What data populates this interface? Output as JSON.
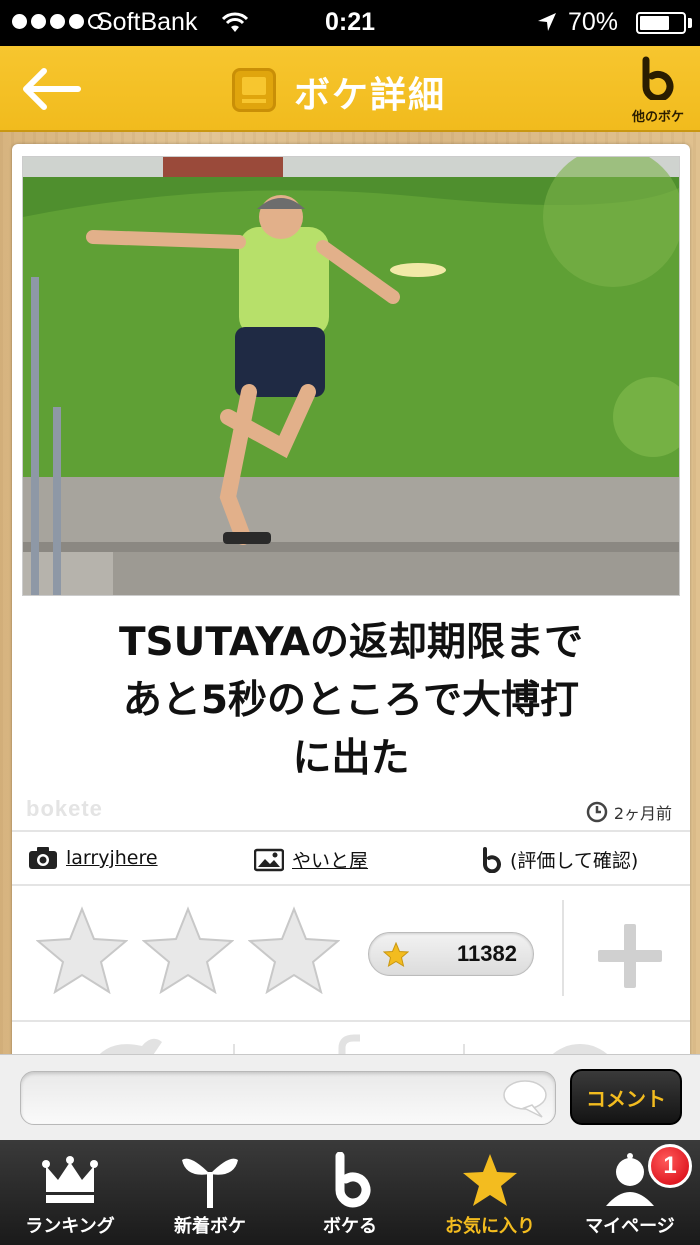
{
  "status_bar": {
    "carrier": "SoftBank",
    "time": "0:21",
    "battery_percent": "70%",
    "battery_level": 0.7
  },
  "nav": {
    "title": "ボケ詳細",
    "other_bokes_label": "他のボケ"
  },
  "post": {
    "caption_lines": [
      "TSUTAYAの返却期限まで",
      "あと5秒のところで大博打",
      "に出た"
    ],
    "watermark": "bokete",
    "time_ago": "2ヶ月前",
    "photographer": "larryjhere",
    "title_author": "やいと屋",
    "rating_hint": "(評価して確認)",
    "star_count": 3,
    "score": "11382"
  },
  "comment": {
    "placeholder": "",
    "button_label": "コメント"
  },
  "tabs": [
    {
      "label": "ランキング",
      "icon": "crown-icon"
    },
    {
      "label": "新着ボケ",
      "icon": "sprout-icon"
    },
    {
      "label": "ボケる",
      "icon": "bokeru-b-icon"
    },
    {
      "label": "お気に入り",
      "icon": "star-icon",
      "active": true
    },
    {
      "label": "マイページ",
      "icon": "mypage-icon",
      "badge": "1"
    }
  ],
  "colors": {
    "accent": "#f3bc1f",
    "nav_bg": "#f7c62f",
    "tabbar_bg": "#222222",
    "badge": "#d4000d"
  }
}
